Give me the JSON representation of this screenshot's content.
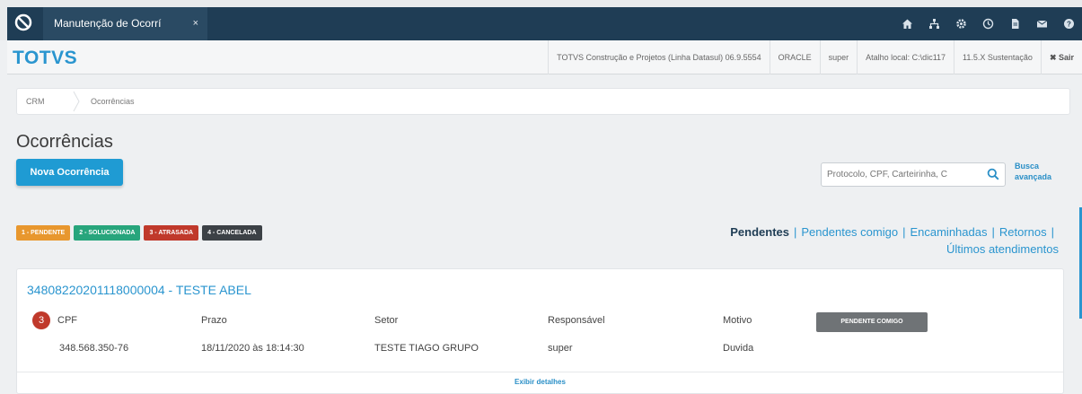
{
  "tab": {
    "title": "Manutenção de Ocorrí",
    "close": "×"
  },
  "topbar_icons": [
    "home-icon",
    "network-icon",
    "gear-icon",
    "clock-icon",
    "document-icon",
    "mail-icon",
    "help-icon"
  ],
  "header": {
    "brand": "TOTVS",
    "product": "TOTVS Construção e Projetos (Linha Datasul) 06.9.5554",
    "database": "ORACLE",
    "user": "super",
    "shortcut": "Atalho local: C:\\dic117",
    "version": "11.5.X Sustentação",
    "exit": "✖ Sair"
  },
  "breadcrumb": [
    "CRM",
    "Ocorrências"
  ],
  "page": {
    "title": "Ocorrências",
    "new_button": "Nova Ocorrência",
    "search_placeholder": "Protocolo, CPF, Carteirinha, C",
    "advanced_search": [
      "Busca",
      "avançada"
    ]
  },
  "status_tags": [
    {
      "label": "1 - PENDENTE",
      "color": "#e8972e"
    },
    {
      "label": "2 - SOLUCIONADA",
      "color": "#27a57c"
    },
    {
      "label": "3 - ATRASADA",
      "color": "#c0392b"
    },
    {
      "label": "4 - CANCELADA",
      "color": "#3c4146"
    }
  ],
  "filters": {
    "active": "Pendentes",
    "links": [
      "Pendentes comigo",
      "Encaminhadas",
      "Retornos",
      "Últimos atendimentos"
    ],
    "separator": "|"
  },
  "occurrence": {
    "title": "34808220201118000004 - TESTE ABEL",
    "status_number": "3",
    "columns": [
      "CPF",
      "Prazo",
      "Setor",
      "Responsável",
      "Motivo"
    ],
    "values": [
      "348.568.350-76",
      "18/11/2020 às 18:14:30",
      "TESTE TIAGO GRUPO",
      "super",
      "Duvida"
    ],
    "status_button": "PENDENTE COMIGO",
    "details_link": "Exibir detalhes"
  }
}
